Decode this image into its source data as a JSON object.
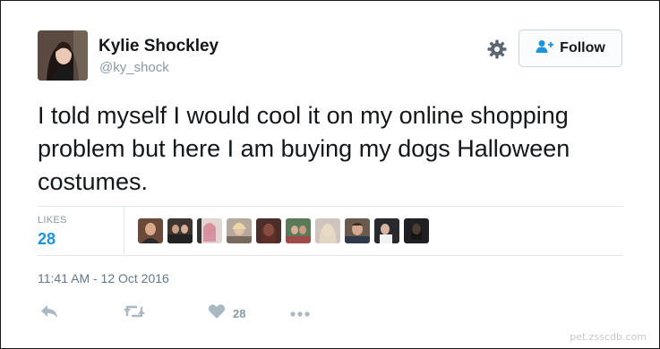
{
  "author": {
    "name": "Kylie Shockley",
    "handle": "@ky_shock"
  },
  "header": {
    "follow_label": "Follow",
    "settings_icon": "gear-icon",
    "follow_icon": "add-user-icon"
  },
  "tweet": {
    "text": "I told myself I would cool it on my online shopping problem but here I am buying my dogs Halloween costumes.",
    "timestamp": "11:41 AM - 12 Oct 2016"
  },
  "stats": {
    "likes_label": "LIKES",
    "likes_count": "28",
    "liker_avatars": 10
  },
  "actions": {
    "reply_icon": "reply-icon",
    "retweet_icon": "retweet-icon",
    "like_icon": "heart-icon",
    "like_count": "28",
    "more_icon": "more-icon"
  },
  "watermark": "pet.zsscdb.com",
  "colors": {
    "accent": "#1b95e0",
    "text": "#14171a",
    "muted": "#8899a6",
    "divider": "#e1e8ed"
  }
}
